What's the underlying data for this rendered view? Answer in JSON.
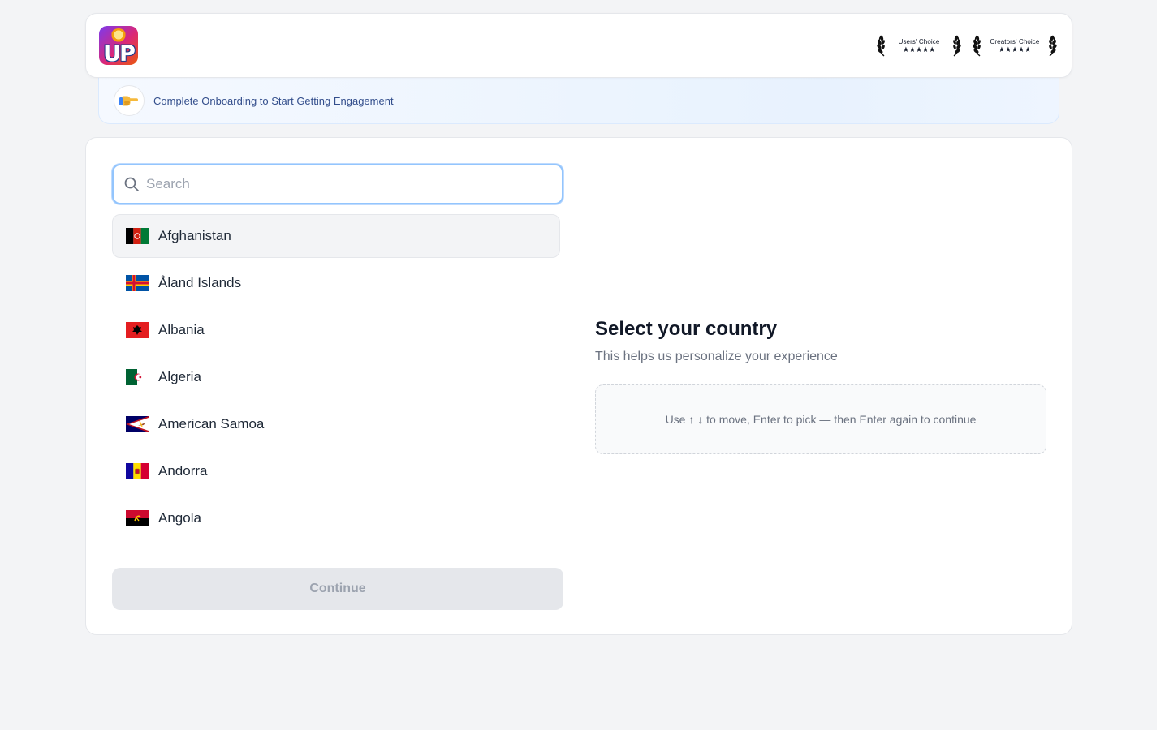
{
  "header": {
    "logo_letters": "UP",
    "badges": [
      {
        "label": "Users' Choice",
        "stars": "★★★★★"
      },
      {
        "label": "Creators' Choice",
        "stars": "★★★★★"
      }
    ]
  },
  "banner": {
    "icon": "pointing-hand-icon",
    "text": "Complete Onboarding to Start Getting Engagement"
  },
  "search": {
    "placeholder": "Search",
    "value": ""
  },
  "countries": [
    {
      "name": "Afghanistan",
      "flag": "flag-afghanistan-icon",
      "selected": true
    },
    {
      "name": "Åland Islands",
      "flag": "flag-aland-islands-icon",
      "selected": false
    },
    {
      "name": "Albania",
      "flag": "flag-albania-icon",
      "selected": false
    },
    {
      "name": "Algeria",
      "flag": "flag-algeria-icon",
      "selected": false
    },
    {
      "name": "American Samoa",
      "flag": "flag-american-samoa-icon",
      "selected": false
    },
    {
      "name": "Andorra",
      "flag": "flag-andorra-icon",
      "selected": false
    },
    {
      "name": "Angola",
      "flag": "flag-angola-icon",
      "selected": false
    }
  ],
  "continue_label": "Continue",
  "panel": {
    "title": "Select your country",
    "subtitle": "This helps us personalize your experience",
    "hint": "Use ↑ ↓ to move, Enter to pick — then Enter again to continue"
  },
  "colors": {
    "accent": "#93c5fd",
    "banner_text": "#334e8c",
    "selected_row": "#f3f4f6",
    "disabled_button": "#e5e7eb"
  }
}
